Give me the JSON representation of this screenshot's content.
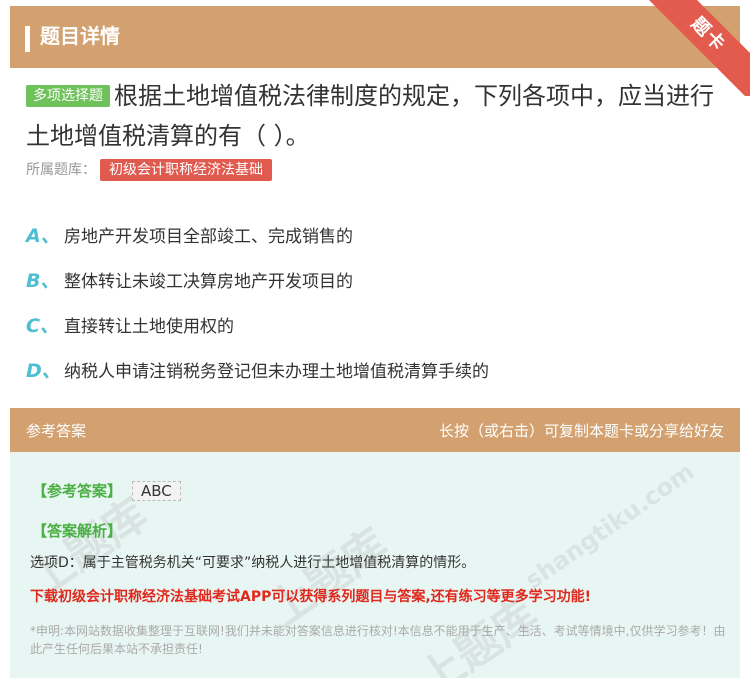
{
  "header": {
    "title": "题目详情",
    "ribbon": "题卡"
  },
  "question": {
    "type_badge": "多项选择题",
    "text": "根据土地增值税法律制度的规定，下列各项中，应当进行土地增值税清算的有（ ）。"
  },
  "bank": {
    "label": "所属题库：",
    "name": "初级会计职称经济法基础"
  },
  "options": [
    {
      "letter": "A、",
      "text": "房地产开发项目全部竣工、完成销售的"
    },
    {
      "letter": "B、",
      "text": "整体转让未竣工决算房地产开发项目的"
    },
    {
      "letter": "C、",
      "text": "直接转让土地使用权的"
    },
    {
      "letter": "D、",
      "text": "纳税人申请注销税务登记但未办理土地增值税清算手续的"
    }
  ],
  "answer_bar": {
    "left": "参考答案",
    "right": "长按（或右击）可复制本题卡或分享给好友"
  },
  "answer": {
    "label": "【参考答案】",
    "value": "ABC",
    "explanation_label": "【答案解析】",
    "explanation": "选项D：属于主管税务机关“可要求”纳税人进行土地增值税清算的情形。",
    "promo": "下载初级会计职称经济法基础考试APP可以获得系列题目与答案,还有练习等更多学习功能!",
    "disclaimer": "*申明:本网站数据收集整理于互联网!我们并未能对答案信息进行核对!本信息不能用于生产、生活、考试等情境中,仅供学习参考！由此产生任何后果本站不承担责任!"
  },
  "watermark": {
    "text": "上题库",
    "site": "shangtiku.com"
  },
  "colors": {
    "header": "#d3a170",
    "ribbon": "#e25b4d",
    "green": "#6fc15b",
    "option_letter": "#4dbfd3",
    "promo": "#e0281d"
  }
}
